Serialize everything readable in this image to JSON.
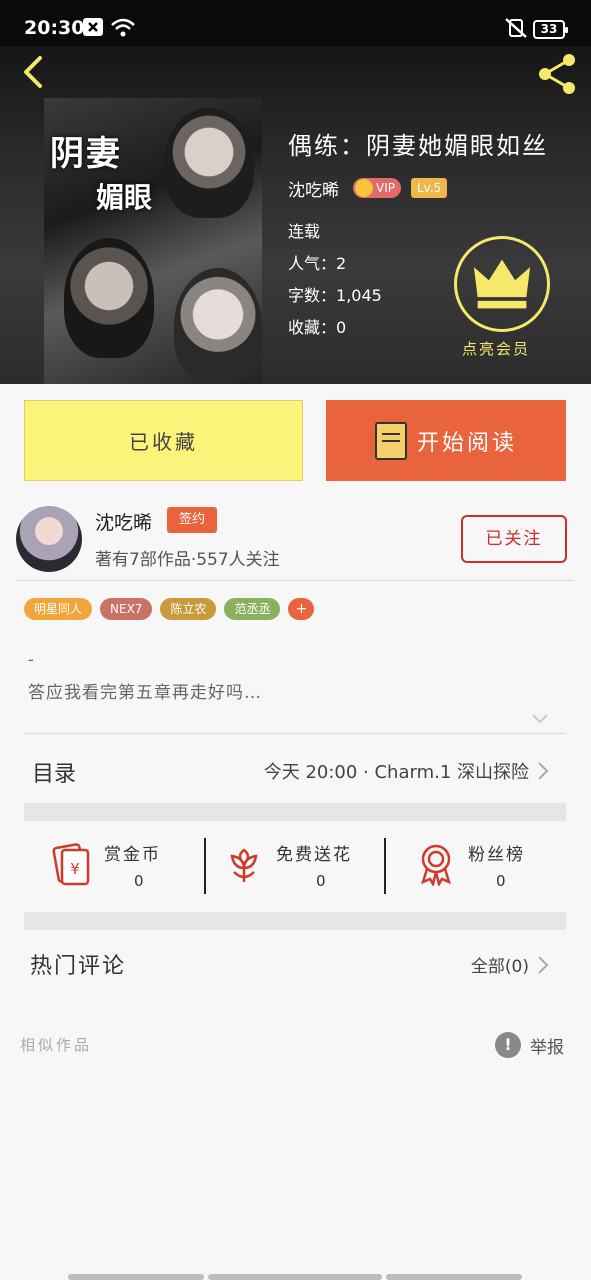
{
  "status_bar": {
    "time": "20:30",
    "battery": "33"
  },
  "book": {
    "title": "偶练：阴妻她媚眼如丝",
    "author": "沈吃晞",
    "vip_label": "VIP",
    "level": "Lv.5",
    "status": "连载",
    "popularity_label": "人气：",
    "popularity": "2",
    "words_label": "字数：",
    "words": "1,045",
    "favorites_label": "收藏：",
    "favorites": "0",
    "cover_title_1": "阴妻",
    "cover_title_2": "媚眼",
    "member_label": "点亮会员"
  },
  "actions": {
    "collected_label": "已收藏",
    "read_label": "开始阅读"
  },
  "author_card": {
    "name": "沈吃晞",
    "badge": "签约",
    "stats": "著有7部作品·557人关注",
    "follow_label": "已关注"
  },
  "tags": [
    {
      "label": "明星同人",
      "color": "#f0a63a"
    },
    {
      "label": "NEX7",
      "color": "#c97265"
    },
    {
      "label": "陈立农",
      "color": "#c99a3c"
    },
    {
      "label": "范丞丞",
      "color": "#8bb15e"
    }
  ],
  "tag_more": "+",
  "intro": {
    "dash": "-",
    "text": "答应我看完第五章再走好吗…"
  },
  "toc": {
    "label": "目录",
    "latest": "今天 20:00 · Charm.1 深山探险"
  },
  "stats": [
    {
      "label": "赏金币",
      "value": "0",
      "icon": "red-envelope-icon"
    },
    {
      "label": "免费送花",
      "value": "0",
      "icon": "flower-icon"
    },
    {
      "label": "粉丝榜",
      "value": "0",
      "icon": "medal-icon"
    }
  ],
  "comments": {
    "label": "热门评论",
    "all_label": "全部(0)"
  },
  "footer": {
    "similar_label": "相似作品",
    "report_label": "举报"
  },
  "colors": {
    "accent": "#e9633d",
    "collect_bg": "#fbf37a",
    "member_gold": "#f5e86a",
    "follow_red": "#c9302c"
  }
}
